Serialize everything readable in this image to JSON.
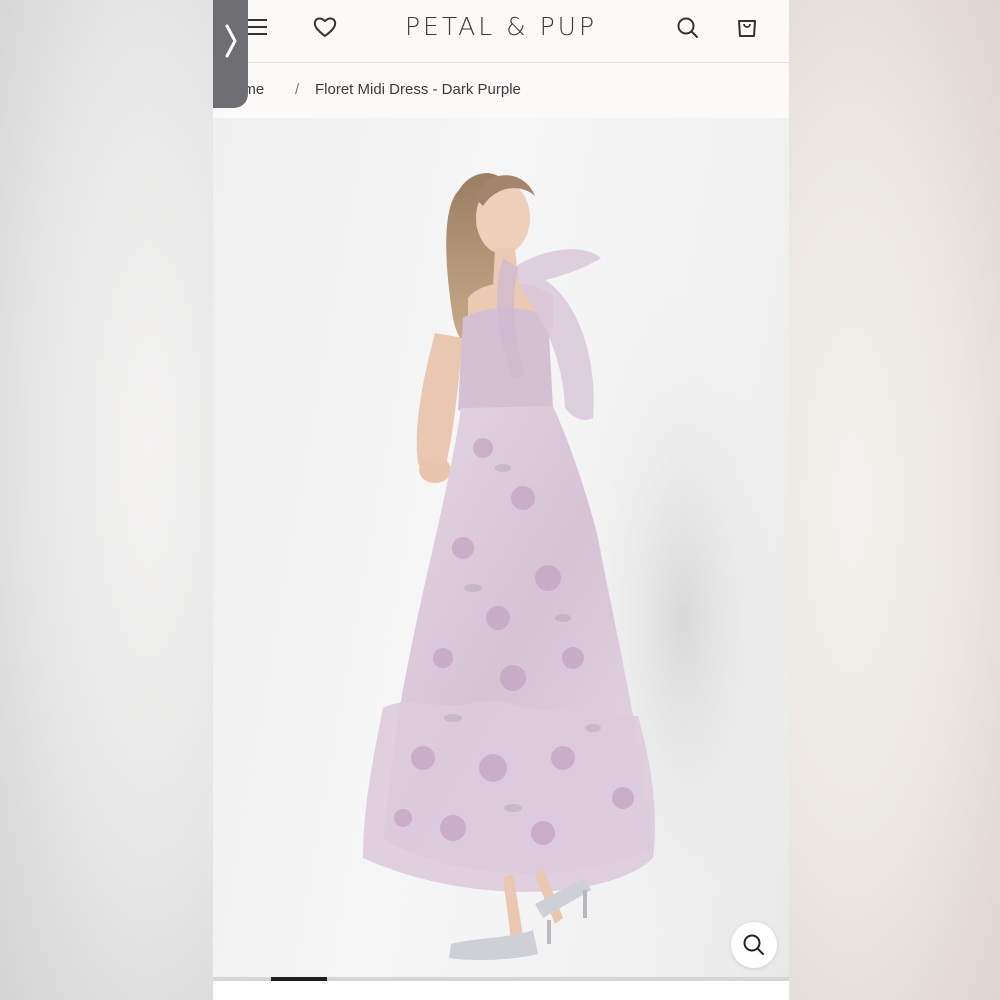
{
  "header": {
    "brand": "PETAL & PUP",
    "icons": [
      "menu-icon",
      "heart-icon",
      "search-icon",
      "bag-icon"
    ]
  },
  "side_handle": {
    "icon": "chevron-right-icon"
  },
  "breadcrumb": {
    "home": "ome",
    "separator": "/",
    "current": "Floret Midi Dress - Dark Purple"
  },
  "product": {
    "image_alt": "Floret Midi Dress - Dark Purple",
    "zoom_icon": "zoom-search-icon",
    "carousel": {
      "active_index": 1
    }
  },
  "colors": {
    "header_bg": "#fbfaf8",
    "text": "#3c3c3c",
    "handle": "#6f6f73",
    "dress": "#d8c4d8"
  }
}
